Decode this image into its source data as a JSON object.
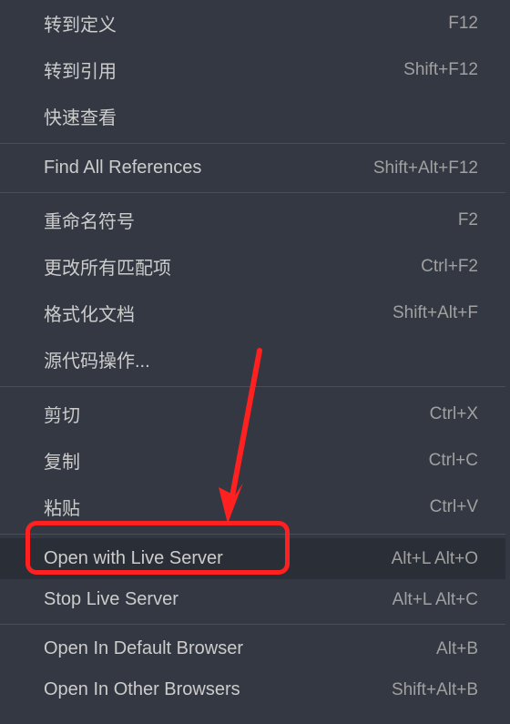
{
  "menu": {
    "groups": [
      [
        {
          "label": "转到定义",
          "shortcut": "F12"
        },
        {
          "label": "转到引用",
          "shortcut": "Shift+F12"
        },
        {
          "label": "快速查看",
          "shortcut": ""
        }
      ],
      [
        {
          "label": "Find All References",
          "shortcut": "Shift+Alt+F12"
        }
      ],
      [
        {
          "label": "重命名符号",
          "shortcut": "F2"
        },
        {
          "label": "更改所有匹配项",
          "shortcut": "Ctrl+F2"
        },
        {
          "label": "格式化文档",
          "shortcut": "Shift+Alt+F"
        },
        {
          "label": "源代码操作...",
          "shortcut": ""
        }
      ],
      [
        {
          "label": "剪切",
          "shortcut": "Ctrl+X"
        },
        {
          "label": "复制",
          "shortcut": "Ctrl+C"
        },
        {
          "label": "粘贴",
          "shortcut": "Ctrl+V"
        }
      ],
      [
        {
          "label": "Open with Live Server",
          "shortcut": "Alt+L Alt+O",
          "hovered": true,
          "highlighted": true
        },
        {
          "label": "Stop Live Server",
          "shortcut": "Alt+L Alt+C"
        }
      ],
      [
        {
          "label": "Open In Default Browser",
          "shortcut": "Alt+B"
        },
        {
          "label": "Open In Other Browsers",
          "shortcut": "Shift+Alt+B"
        }
      ]
    ]
  },
  "annotation": {
    "highlight_color": "#ff2020",
    "arrow_color": "#ff2020"
  }
}
